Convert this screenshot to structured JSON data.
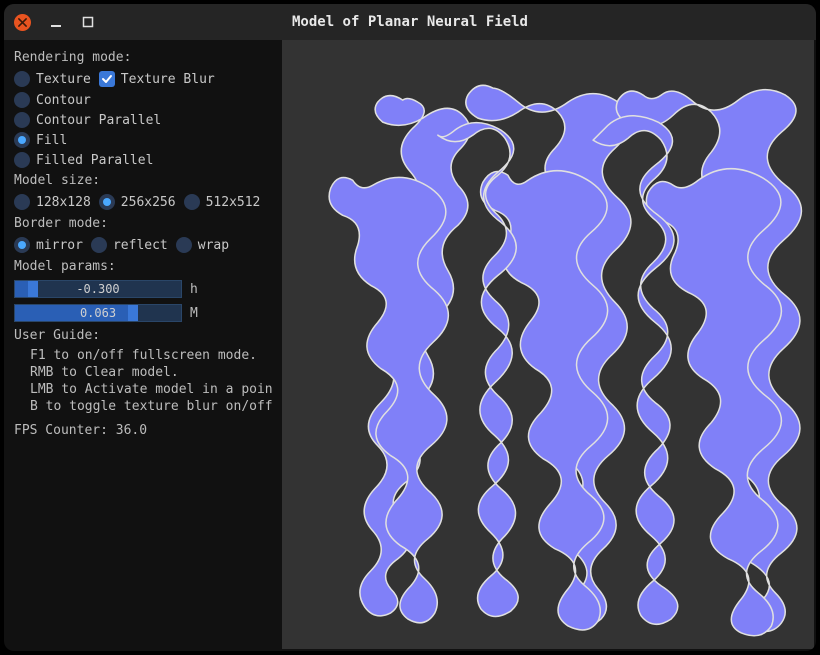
{
  "window": {
    "title": "Model of Planar Neural Field"
  },
  "rendering_mode": {
    "label": "Rendering mode:",
    "options": {
      "texture": "Texture",
      "texture_blur": "Texture Blur",
      "contour": "Contour",
      "contour_parallel": "Contour Parallel",
      "fill": "Fill",
      "filled_parallel": "Filled Parallel"
    },
    "selected": "fill",
    "texture_blur_checked": true
  },
  "model_size": {
    "label": "Model size:",
    "options": {
      "s128": "128x128",
      "s256": "256x256",
      "s512": "512x512"
    },
    "selected": "s256"
  },
  "border_mode": {
    "label": "Border mode:",
    "options": {
      "mirror": "mirror",
      "reflect": "reflect",
      "wrap": "wrap"
    },
    "selected": "mirror"
  },
  "model_params": {
    "label": "Model params:",
    "h": {
      "value": "-0.300",
      "label": "h",
      "fill_pct": 8,
      "handle_pct": 8
    },
    "m": {
      "value": "0.063",
      "label": "M",
      "fill_pct": 68,
      "handle_pct": 68
    }
  },
  "user_guide": {
    "label": "User Guide:",
    "items": [
      "F1 to on/off fullscreen mode.",
      "RMB to Clear model.",
      "LMB to Activate model in a poin",
      "B to toggle texture blur on/off"
    ]
  },
  "fps": {
    "label": "FPS Counter: ",
    "value": "36.0"
  },
  "colors": {
    "fill": "#8080f8",
    "outline": "#e0e0e0",
    "canvas_bg": "#333333"
  }
}
